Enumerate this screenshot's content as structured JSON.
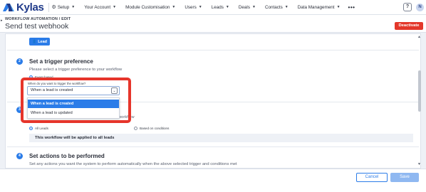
{
  "nav": {
    "brand": "Kylas",
    "items": [
      {
        "label": "Setup",
        "has_gear": true
      },
      {
        "label": "Your Account"
      },
      {
        "label": "Module Customisation"
      },
      {
        "label": "Users"
      },
      {
        "label": "Leads"
      },
      {
        "label": "Deals"
      },
      {
        "label": "Contacts"
      },
      {
        "label": "Data Management"
      }
    ],
    "more": "•••",
    "help": "?",
    "avatar": "N"
  },
  "header": {
    "breadcrumb": "WORKFLOW AUTOMATION / EDIT",
    "title": "Send test webhook",
    "deactivate": "Deactivate"
  },
  "entity_chip": "Lead",
  "step2": {
    "number": "2",
    "title": "Set a trigger preference",
    "desc": "Please select a trigger preference to your workflow",
    "radio_label": "Event based",
    "field_label": "When do you want to trigger the workflow?",
    "selected": "When a lead is created",
    "options": [
      "When a lead is created",
      "When a lead is updated"
    ]
  },
  "step3": {
    "number": "3",
    "desc_tail": "workflow",
    "radio_all": "All Leads",
    "radio_conditions": "Based on conditions",
    "info": "This workflow will be applied to all leads"
  },
  "step4": {
    "number": "4",
    "title": "Set actions to be performed",
    "desc": "Set any actions you want the system to perform automatically when the above selected trigger and conditions met"
  },
  "footer": {
    "cancel": "Cancel",
    "save": "Save"
  },
  "colors": {
    "accent": "#2b7ce8",
    "danger": "#e3372a",
    "highlight": "#e6352b"
  }
}
